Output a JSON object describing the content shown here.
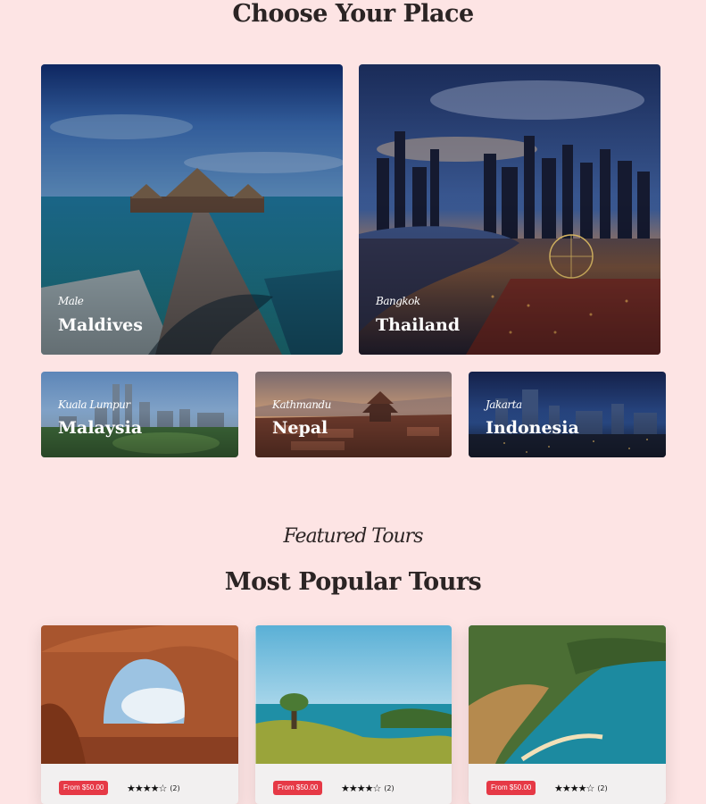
{
  "section1": {
    "title": "Choose Your Place"
  },
  "destinations": [
    {
      "city": "Male",
      "country": "Maldives"
    },
    {
      "city": "Bangkok",
      "country": "Thailand"
    },
    {
      "city": "Kuala Lumpur",
      "country": "Malaysia"
    },
    {
      "city": "Kathmandu",
      "country": "Nepal"
    },
    {
      "city": "Jakarta",
      "country": "Indonesia"
    }
  ],
  "section2": {
    "subtitle": "Featured Tours",
    "title": "Most Popular Tours"
  },
  "tours": [
    {
      "price": "From $50.00",
      "rating": 4,
      "stars": "★★★★☆",
      "reviews": "(2)"
    },
    {
      "price": "From $50.00",
      "rating": 4,
      "stars": "★★★★☆",
      "reviews": "(2)"
    },
    {
      "price": "From $50.00",
      "rating": 4,
      "stars": "★★★★☆",
      "reviews": "(2)"
    }
  ]
}
